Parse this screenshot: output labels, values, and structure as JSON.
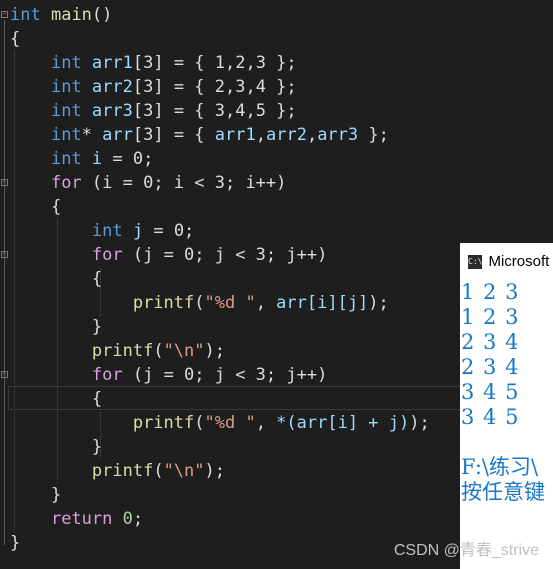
{
  "code": {
    "l1_int": "int",
    "l1_main": "main",
    "l1_rest": "()",
    "brace_open": "{",
    "brace_close": "}",
    "arr_int": "int",
    "arr1_name": "arr1",
    "arr1_tail": "[3] = { 1,2,3 };",
    "arr2_name": "arr2",
    "arr2_tail": "[3] = { 2,3,4 };",
    "arr3_name": "arr3",
    "arr3_tail": "[3] = { 3,4,5 };",
    "ptr_star": "*",
    "ptr_arr": "arr",
    "ptr_tail": "[3] = { ",
    "ptr_a1": "arr1",
    "ptr_a2": "arr2",
    "ptr_a3": "arr3",
    "ptr_end": " };",
    "i_var": "i",
    "i_tail": " = 0;",
    "for_kw": "for",
    "for_i": "(i = 0; i < 3; i++)",
    "j_var": "j",
    "j_tail": " = 0;",
    "for_j": "(j = 0; j < 3; j++)",
    "printf": "printf",
    "p1_str": "\"%d \"",
    "p1_arr": "arr[i][j]",
    "nl_str": "\"\\n\"",
    "p2_str": "\"%d \"",
    "p2_expr": "*(arr[i] + j)",
    "return_kw": "return",
    "return_val": "0"
  },
  "console": {
    "title": "Microsoft Visual Studio Debug Console",
    "lines": [
      "1 2 3",
      "1 2 3",
      "2 3 4",
      "2 3 4",
      "3 4 5",
      "3 4 5"
    ],
    "path_line": "F:\\练习\\",
    "prompt_line": "按任意键"
  },
  "watermark": "CSDN @青春_strive"
}
